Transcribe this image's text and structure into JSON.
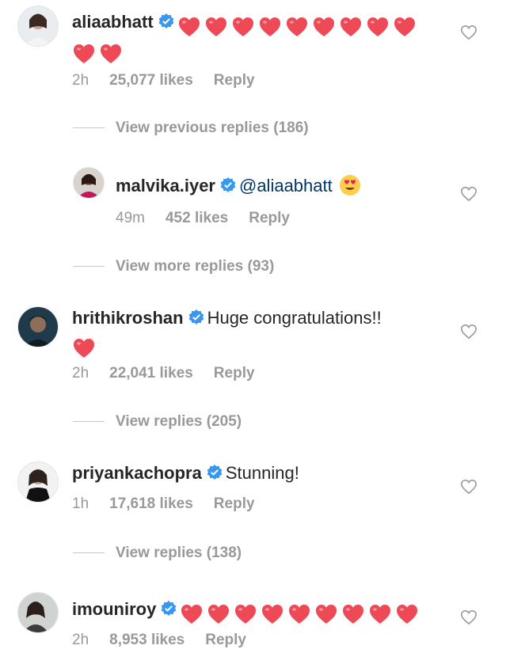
{
  "colors": {
    "text": "#262626",
    "meta": "#999999",
    "verified": "#3897f0",
    "heart": "#ed4956",
    "mention": "#003569"
  },
  "comments": [
    {
      "username": "aliaabhatt",
      "verified": true,
      "text": "",
      "hearts": 11,
      "time": "2h",
      "likes": "25,077 likes",
      "reply": "Reply",
      "icon": "heart-outline-icon"
    },
    {
      "username": "malvika.iyer",
      "verified": true,
      "text": "@aliaabhatt",
      "emoji": "heart-eyes-emoji",
      "time": "49m",
      "likes": "452 likes",
      "reply": "Reply",
      "icon": "heart-outline-icon"
    },
    {
      "username": "hrithikroshan",
      "verified": true,
      "text": "Huge congratulations!!",
      "hearts": 1,
      "time": "2h",
      "likes": "22,041 likes",
      "reply": "Reply",
      "icon": "heart-outline-icon"
    },
    {
      "username": "priyankachopra",
      "verified": true,
      "text": "Stunning!",
      "time": "1h",
      "likes": "17,618 likes",
      "reply": "Reply",
      "icon": "heart-outline-icon"
    },
    {
      "username": "imouniroy",
      "verified": true,
      "text": "",
      "hearts": 9,
      "time": "2h",
      "likes": "8,953 likes",
      "reply": "Reply",
      "icon": "heart-outline-icon"
    }
  ],
  "view_links": [
    "View previous replies (186)",
    "View more replies (93)",
    "View replies (205)",
    "View replies (138)"
  ]
}
